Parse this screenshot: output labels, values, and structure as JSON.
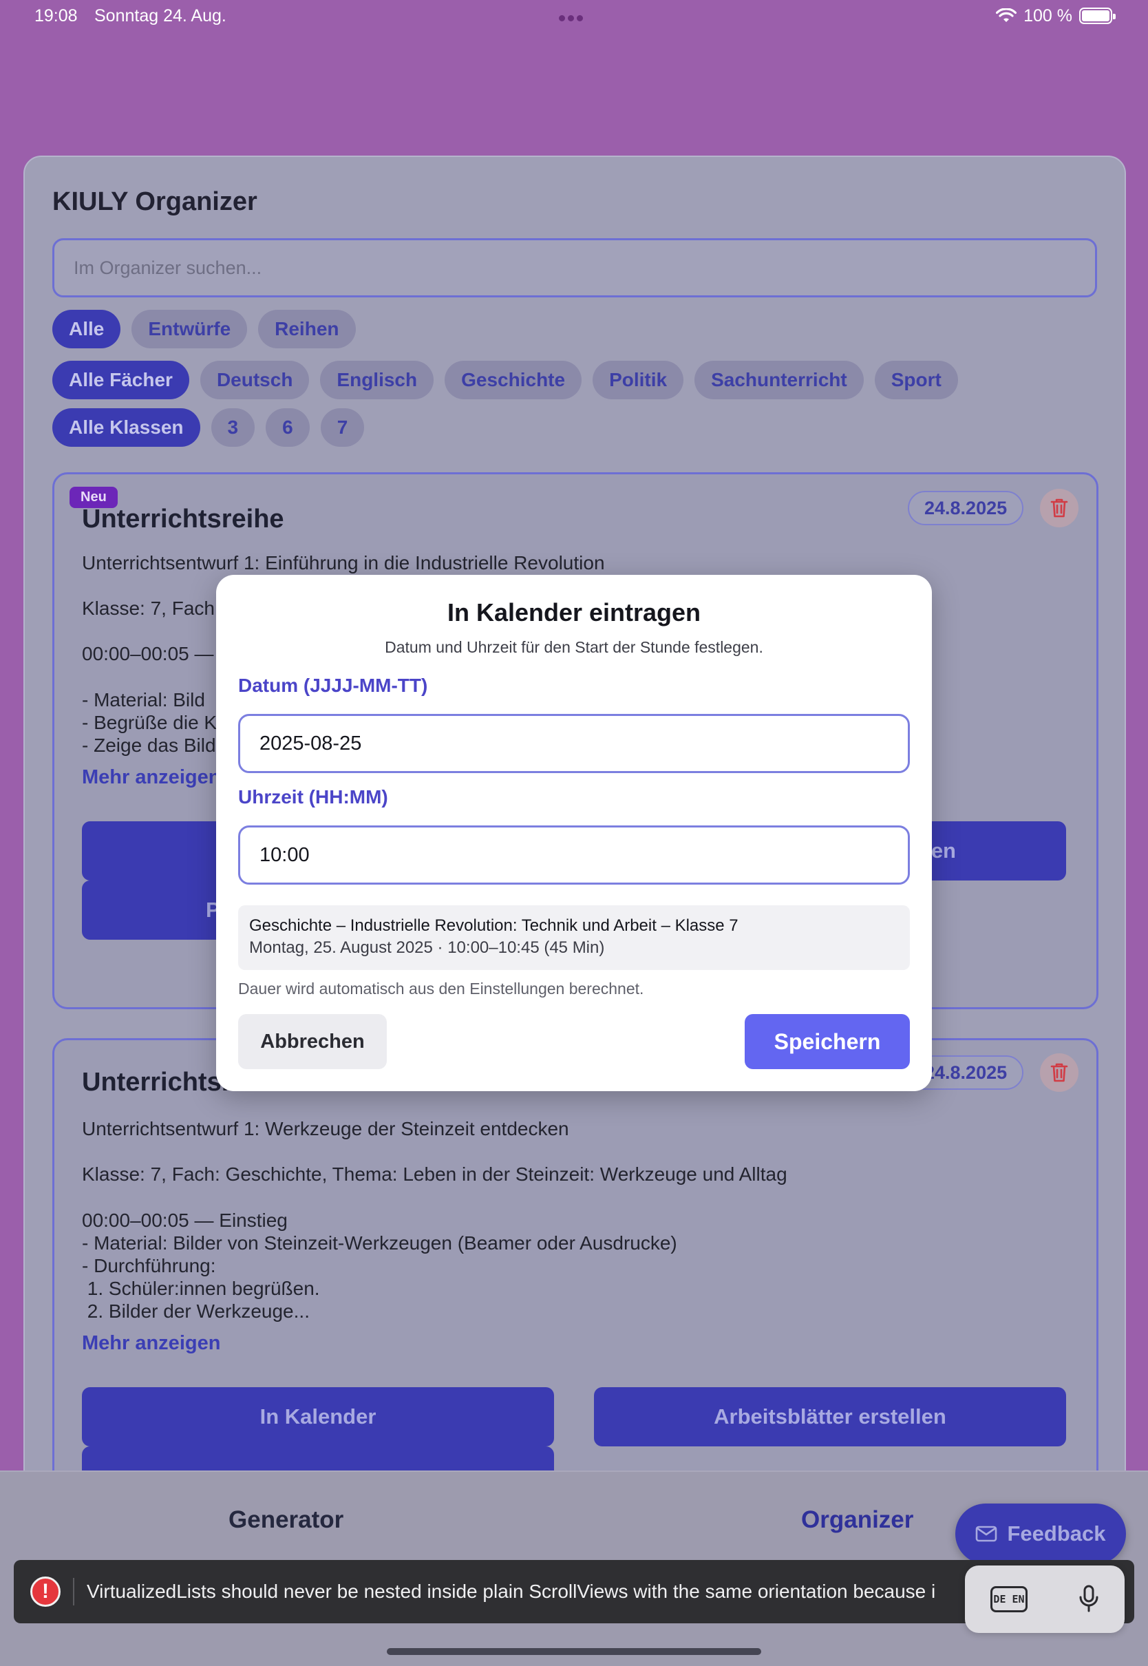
{
  "status_bar": {
    "time": "19:08",
    "date": "Sonntag 24. Aug.",
    "battery": "100 %",
    "wifi_icon": "wifi-icon",
    "battery_icon": "battery-icon"
  },
  "app": {
    "title": "KIULY Organizer"
  },
  "search": {
    "placeholder": "Im Organizer suchen..."
  },
  "filters": {
    "types": [
      "Alle",
      "Entwürfe",
      "Reihen"
    ],
    "subjects": [
      "Alle Fächer",
      "Deutsch",
      "Englisch",
      "Geschichte",
      "Politik",
      "Sachunterricht",
      "Sport"
    ],
    "classes": [
      "Alle Klassen",
      "3",
      "6",
      "7"
    ],
    "active": {
      "type": "Alle",
      "subject": "Alle Fächer",
      "class": "Alle Klassen"
    }
  },
  "cards": [
    {
      "badge": "Neu",
      "title": "Unterrichtsreihe",
      "date": "24.8.2025",
      "lines": [
        "Unterrichtsentwurf 1: Einführung in die Industrielle Revolution",
        "",
        "Klasse: 7, Fach:",
        "",
        "00:00–00:05 —",
        "",
        "- Material: Bild",
        "- Begrüße die K",
        "- Zeige das Bild"
      ],
      "more": "Mehr anzeigen",
      "button_right_fragment": "en",
      "button_left_fragment": "P"
    },
    {
      "title": "Unterrichtsreihe",
      "date": "24.8.2025",
      "lines": [
        "Unterrichtsentwurf 1: Werkzeuge der Steinzeit entdecken",
        "",
        "Klasse: 7, Fach: Geschichte, Thema: Leben in der Steinzeit: Werkzeuge und Alltag",
        "",
        "00:00–00:05 — Einstieg",
        "- Material: Bilder von Steinzeit-Werkzeugen (Beamer oder Ausdrucke)",
        "- Durchführung:",
        " 1. Schüler:innen begrüßen.",
        " 2. Bilder der Werkzeuge..."
      ],
      "more": "Mehr anzeigen",
      "buttons": [
        "In Kalender",
        "Arbeitsblätter erstellen"
      ]
    }
  ],
  "modal": {
    "title": "In Kalender eintragen",
    "subtitle": "Datum und Uhrzeit für den Start der Stunde festlegen.",
    "date_label": "Datum (JJJJ-MM-TT)",
    "date_value": "2025-08-25",
    "time_label": "Uhrzeit (HH:MM)",
    "time_value": "10:00",
    "preview_line1": "Geschichte – Industrielle Revolution: Technik und Arbeit – Klasse 7",
    "preview_line2": "Montag, 25. August 2025 · 10:00–10:45 (45 Min)",
    "hint": "Dauer wird automatisch aus den Einstellungen berechnet.",
    "cancel": "Abbrechen",
    "save": "Speichern"
  },
  "tabbar": {
    "generator": "Generator",
    "organizer": "Organizer",
    "active": "Organizer"
  },
  "feedback": {
    "label": "Feedback",
    "icon": "mail-icon"
  },
  "error": {
    "icon": "!",
    "message": "VirtualizedLists should never be nested inside plain ScrollViews with the same orientation because i"
  },
  "keyboard_widget": {
    "lang_label": "DE EN",
    "mic_icon": "microphone-icon"
  },
  "colors": {
    "accent": "#3b3bb1",
    "save": "#6366f1",
    "label": "#4b45c8",
    "error": "#e5373d",
    "new_badge": "#6c26b8"
  }
}
